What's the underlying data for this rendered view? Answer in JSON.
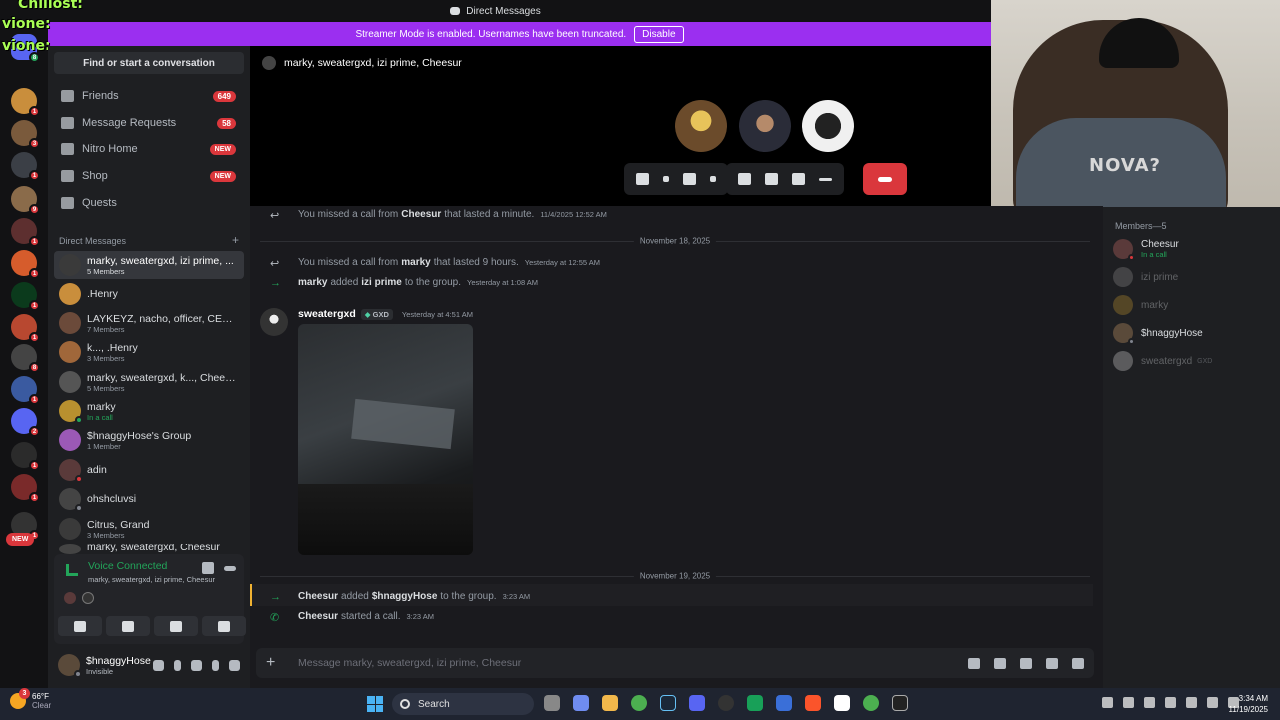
{
  "window_title": "Direct Messages",
  "stream_overlay": {
    "lines": [
      "Chillost:",
      "vione:",
      "vione:"
    ]
  },
  "banner": {
    "text": "Streamer Mode is enabled. Usernames have been truncated.",
    "button": "Disable"
  },
  "sidebar": {
    "find_label": "Find or start a conversation",
    "nav": [
      {
        "label": "Friends",
        "count": "649"
      },
      {
        "label": "Message Requests",
        "count": "58"
      },
      {
        "label": "Nitro Home",
        "badge": "NEW"
      },
      {
        "label": "Shop",
        "badge": "NEW"
      },
      {
        "label": "Quests"
      }
    ],
    "dm_header": "Direct Messages",
    "dm_add": "+",
    "dms": [
      {
        "name": "marky, sweatergxd, izi prime, ...",
        "sub": "5 Members",
        "active": true
      },
      {
        "name": ".Henry",
        "sub": ""
      },
      {
        "name": "LAYKEYZ, nacho, officer, CEO...",
        "sub": "7 Members"
      },
      {
        "name": "k..., .Henry",
        "sub": "3 Members"
      },
      {
        "name": "marky, sweatergxd, k..., Chees...",
        "sub": "5 Members"
      },
      {
        "name": "marky",
        "sub": "In a call"
      },
      {
        "name": "$hnaggyHose's Group",
        "sub": "1 Member"
      },
      {
        "name": "adin",
        "sub": ""
      },
      {
        "name": "ohshcluvsi",
        "sub": ""
      },
      {
        "name": "Citrus, Grand",
        "sub": "3 Members"
      },
      {
        "name": "marky, sweatergxd, Cheesur",
        "sub": ""
      }
    ],
    "guild_new_badge": "NEW",
    "voice": {
      "status": "Voice Connected",
      "channel": "marky, sweatergxd, izi prime, Cheesur"
    },
    "user": {
      "name": "$hnaggyHose",
      "status": "Invisible"
    }
  },
  "call": {
    "title": "marky, sweatergxd, izi prime, Cheesur"
  },
  "webcam": {
    "shirt_text": "NOVA?"
  },
  "chat": {
    "messages": [
      {
        "type": "missed",
        "pre": "You missed a call from",
        "who": "Cheesur",
        "post": "that lasted a minute.",
        "time": "11/4/2025 12:52 AM"
      },
      {
        "type": "date",
        "text": "November 18, 2025"
      },
      {
        "type": "missed",
        "pre": "You missed a call from",
        "who": "marky",
        "post": "that lasted 9 hours.",
        "time": "Yesterday at 12:55 AM"
      },
      {
        "type": "added",
        "who": "marky",
        "mid": "added",
        "target": "izi prime",
        "post": "to the group.",
        "time": "Yesterday at 1:08 AM"
      },
      {
        "type": "msg",
        "author": "sweatergxd",
        "tag": "GXD",
        "time": "Yesterday at 4:51 AM"
      },
      {
        "type": "date",
        "text": "November 19, 2025"
      },
      {
        "type": "added",
        "who": "Cheesur",
        "mid": "added",
        "target": "$hnaggyHose",
        "post": "to the group.",
        "time": "3:23 AM"
      },
      {
        "type": "started",
        "who": "Cheesur",
        "post": "started a call.",
        "time": "3:23 AM"
      }
    ],
    "composer_placeholder": "Message marky, sweatergxd, izi prime, Cheesur"
  },
  "members": {
    "header": "Members—5",
    "list": [
      {
        "name": "Cheesur",
        "sub": "In a call",
        "dim": false
      },
      {
        "name": "izi prime",
        "sub": "",
        "dim": true
      },
      {
        "name": "marky",
        "sub": "",
        "dim": true
      },
      {
        "name": "$hnaggyHose",
        "sub": "",
        "dim": false
      },
      {
        "name": "sweatergxd",
        "sub": "GXD",
        "dim": true
      }
    ]
  },
  "taskbar": {
    "weather_temp": "66°F",
    "weather_desc": "Clear",
    "weather_badge": "3",
    "search_label": "Search",
    "time": "3:34 AM",
    "date": "11/19/2025"
  },
  "colors": {
    "accent": "#9b2ff0",
    "online": "#23a55a",
    "danger": "#da373c",
    "idle": "#f0b232"
  }
}
